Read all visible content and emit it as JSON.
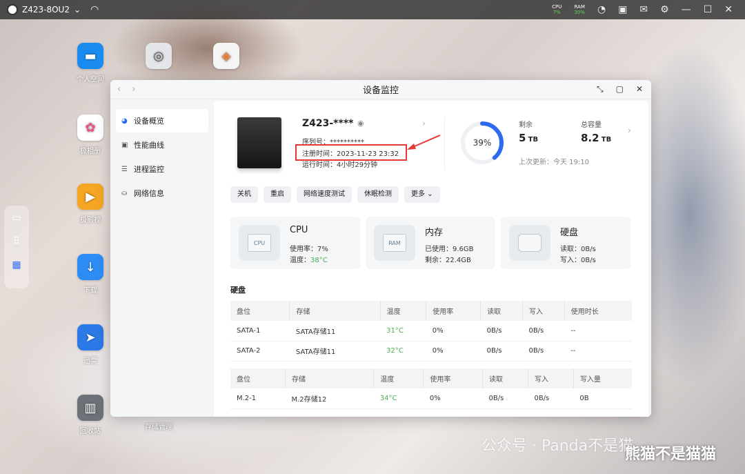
{
  "topbar": {
    "device_name": "Z423-8OU2",
    "cpu_label": "CPU",
    "cpu_value": "7%",
    "ram_label": "RAM",
    "ram_value": "30%"
  },
  "desktop": {
    "icons": [
      "个人空间",
      "极相册",
      "极影视",
      "下载",
      "迅雷",
      "回收站",
      "存储管理"
    ]
  },
  "window": {
    "title": "设备监控",
    "sidebar": [
      {
        "label": "设备概览"
      },
      {
        "label": "性能曲线"
      },
      {
        "label": "进程监控"
      },
      {
        "label": "网络信息"
      }
    ]
  },
  "device": {
    "name": "Z423-****",
    "serial_label": "序列号：",
    "serial_value": "**********",
    "reg_label": "注册时间：",
    "reg_value": "2023-11-23 23:32",
    "uptime_label": "运行时间：",
    "uptime_value": "4小时29分钟"
  },
  "storage": {
    "percent_used": 39,
    "percent_label": "39%",
    "free_label": "剩余",
    "free_value": "5",
    "free_unit": "TB",
    "total_label": "总容量",
    "total_value": "8.2",
    "total_unit": "TB",
    "updated": "上次更新：今天 19:10"
  },
  "actions": [
    "关机",
    "重启",
    "网络速度测试",
    "休眠检测",
    "更多"
  ],
  "cards": {
    "cpu": {
      "title": "CPU",
      "chip": "CPU",
      "usage_label": "使用率：",
      "usage": "7%",
      "temp_label": "温度：",
      "temp": "38°C"
    },
    "mem": {
      "title": "内存",
      "chip": "RAM",
      "used_label": "已使用：",
      "used": "9.6GB",
      "free_label": "剩余：",
      "free": "22.4GB"
    },
    "disk": {
      "title": "硬盘",
      "read_label": "读取：",
      "read": "0B/s",
      "write_label": "写入：",
      "write": "0B/s"
    }
  },
  "disk_section_title": "硬盘",
  "sata_table": {
    "headers": [
      "盘位",
      "存储",
      "温度",
      "使用率",
      "读取",
      "写入",
      "使用时长"
    ],
    "rows": [
      [
        "SATA-1",
        "SATA存储11",
        "31°C",
        "0%",
        "0B/s",
        "0B/s",
        "--"
      ],
      [
        "SATA-2",
        "SATA存储11",
        "32°C",
        "0%",
        "0B/s",
        "0B/s",
        "--"
      ]
    ]
  },
  "m2_table": {
    "headers": [
      "盘位",
      "存储",
      "温度",
      "使用率",
      "读取",
      "写入",
      "写入量"
    ],
    "rows": [
      [
        "M.2-1",
        "M.2存储12",
        "34°C",
        "0%",
        "0B/s",
        "0B/s",
        "0B"
      ]
    ]
  },
  "watermark": {
    "line1": "公众号 · Panda不是猫",
    "line2": "熊猫不是猫猫"
  },
  "colors": {
    "accent": "#2f6bf0",
    "temp_green": "#4caf50",
    "highlight_red": "#e53935"
  }
}
